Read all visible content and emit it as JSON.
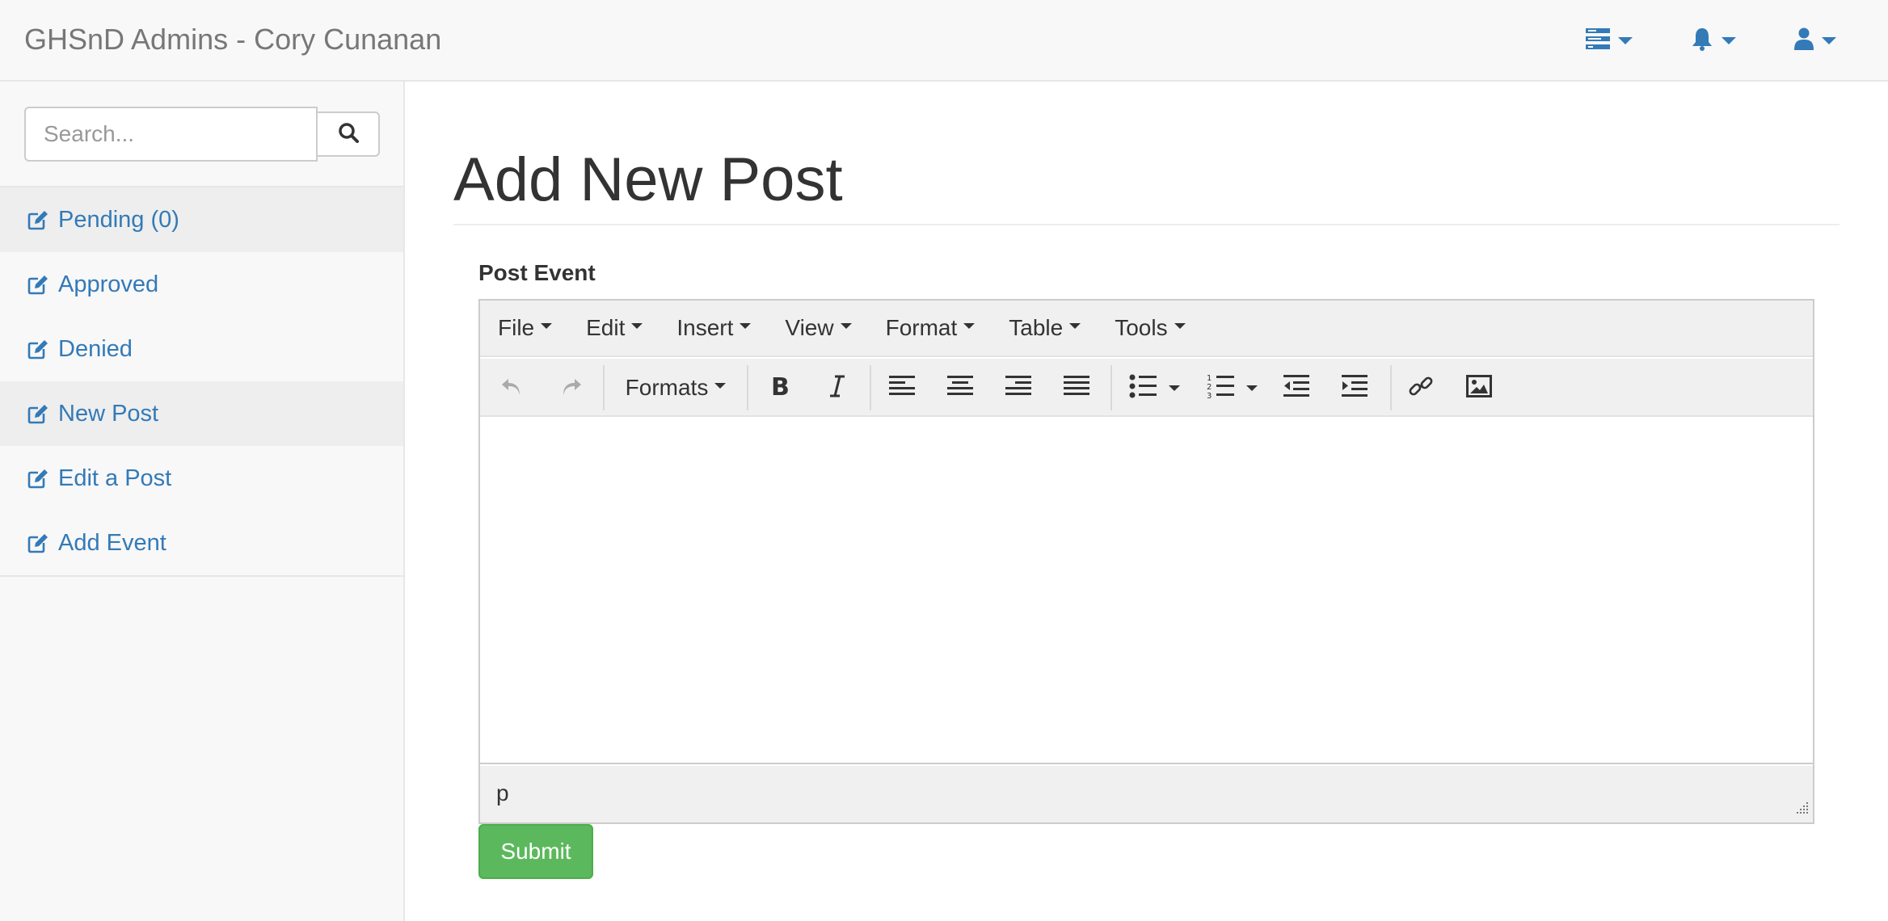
{
  "navbar": {
    "brand": "GHSnD Admins - Cory Cunanan",
    "icons": [
      "tasks-icon",
      "bell-icon",
      "user-icon"
    ],
    "accent": "#337ab7"
  },
  "sidebar": {
    "search": {
      "placeholder": "Search...",
      "value": ""
    },
    "items": [
      {
        "label": "Pending (0)",
        "icon": "edit-icon",
        "active": true
      },
      {
        "label": "Approved",
        "icon": "edit-icon",
        "active": false
      },
      {
        "label": "Denied",
        "icon": "edit-icon",
        "active": false
      },
      {
        "label": "New Post",
        "icon": "edit-icon",
        "active": true
      },
      {
        "label": "Edit a Post",
        "icon": "edit-icon",
        "active": false
      },
      {
        "label": "Add Event",
        "icon": "edit-icon",
        "active": false
      }
    ]
  },
  "main": {
    "title": "Add New Post",
    "field_label": "Post Event",
    "editor": {
      "menu": [
        "File",
        "Edit",
        "Insert",
        "View",
        "Format",
        "Table",
        "Tools"
      ],
      "formats_label": "Formats",
      "path": "p"
    },
    "submit_label": "Submit",
    "submit_color": "#5cb85c"
  }
}
